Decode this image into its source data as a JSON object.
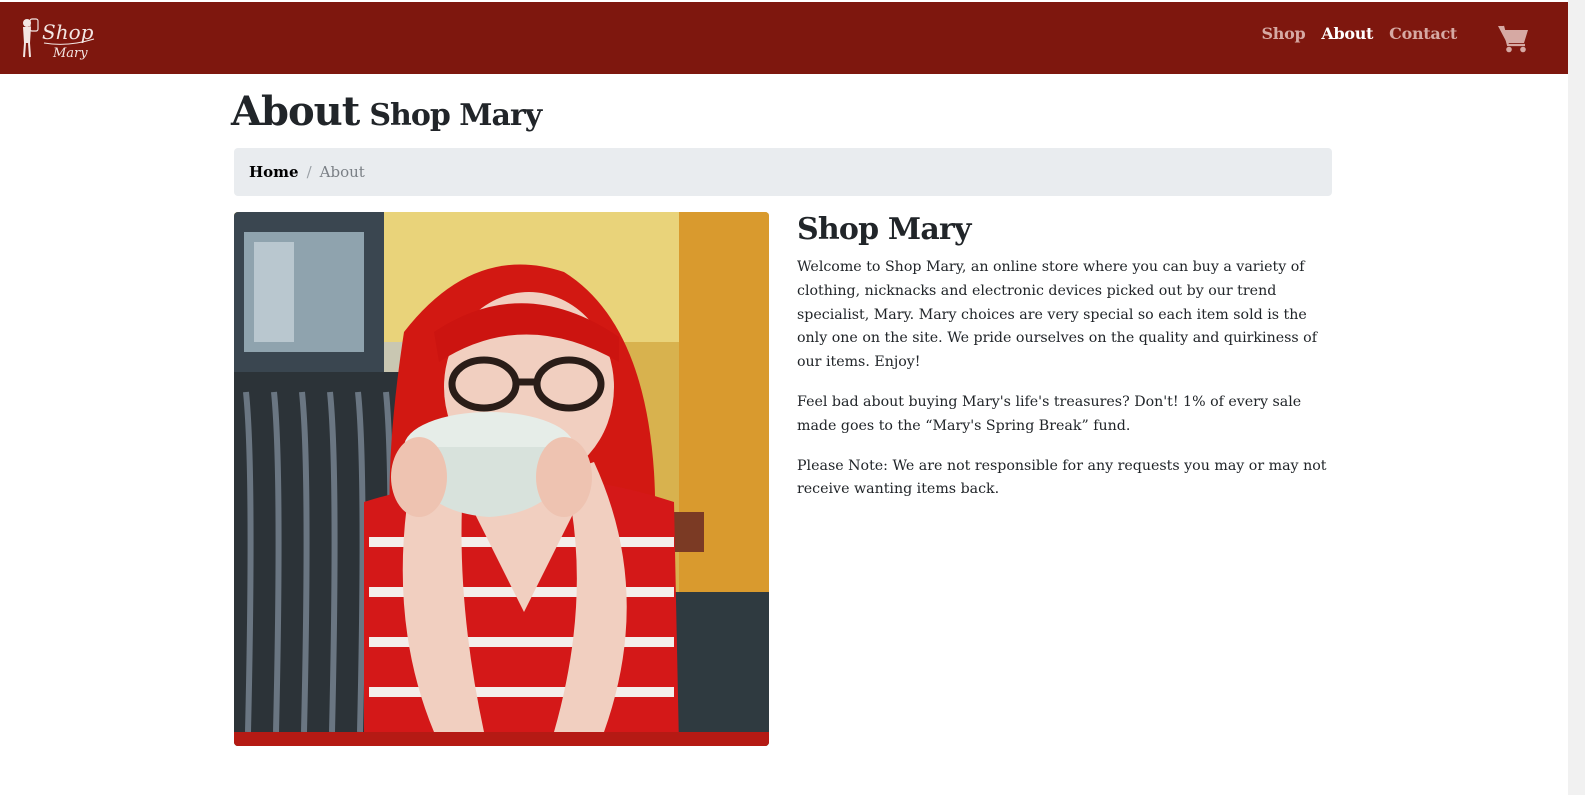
{
  "brand": {
    "line1": "Shop",
    "line2": "Mary"
  },
  "nav": {
    "links": [
      {
        "label": "Shop",
        "active": false
      },
      {
        "label": "About",
        "active": true
      },
      {
        "label": "Contact",
        "active": false
      }
    ],
    "cart_icon": "shopping-cart-icon"
  },
  "page": {
    "heading_main": "About",
    "heading_sub": "Shop Mary"
  },
  "breadcrumb": {
    "home": "Home",
    "separator": "/",
    "current": "About"
  },
  "about": {
    "title": "Shop Mary",
    "paragraphs": [
      "Welcome to Shop Mary, an online store where you can buy a variety of clothing, nicknacks and electronic devices picked out by our trend specialist, Mary. Mary choices are very special so each item sold is the only one on the site. We pride ourselves on the quality and quirkiness of our items. Enjoy!",
      "Feel bad about buying Mary's life's treasures? Don't! 1% of every sale made goes to the “Mary's Spring Break” fund.",
      "Please Note: We are not responsible for any requests you may or may not receive wanting items back."
    ]
  },
  "colors": {
    "navbar": "#7e170e",
    "nav_link": "#d6a9a3",
    "nav_link_active": "#ffffff",
    "breadcrumb_bg": "#e9ecef"
  }
}
